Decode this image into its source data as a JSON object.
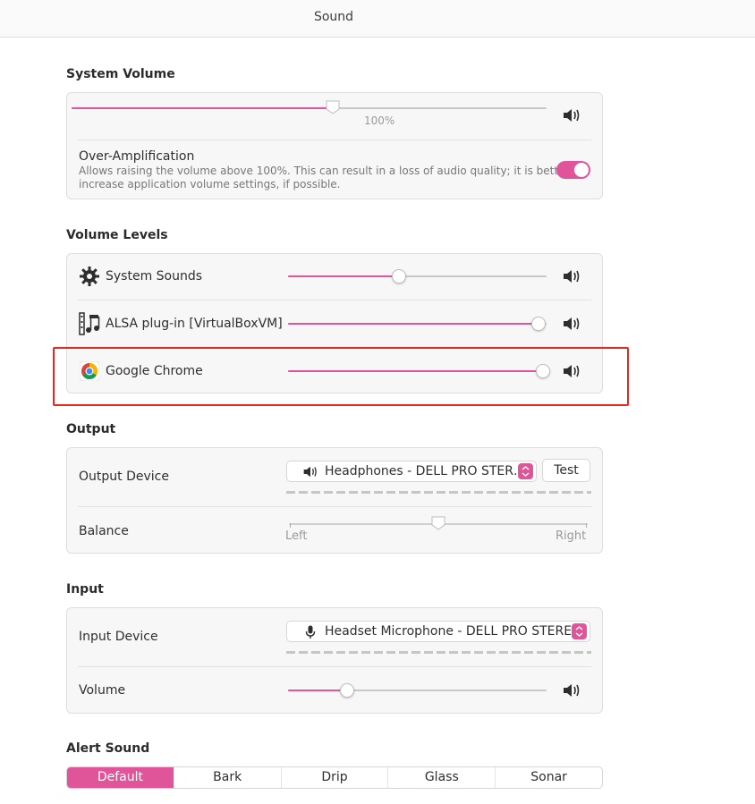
{
  "window": {
    "title": "Sound"
  },
  "system_volume": {
    "section_title": "System Volume",
    "level_percent": 55,
    "value_label": "100%",
    "over_amplification": {
      "label": "Over-Amplification",
      "description_line1": "Allows raising the volume above 100%. This can result in a loss of audio quality; it is better to",
      "description_line2": "increase application volume settings, if possible.",
      "enabled": true
    }
  },
  "volume_levels": {
    "section_title": "Volume Levels",
    "items": [
      {
        "label": "System Sounds",
        "icon": "gear-icon",
        "level_percent": 43
      },
      {
        "label": "ALSA plug-in [VirtualBoxVM]",
        "icon": "film-music-icon",
        "level_percent": 97
      },
      {
        "label": "Google Chrome",
        "icon": "chrome-icon",
        "level_percent": 100
      }
    ]
  },
  "output": {
    "section_title": "Output",
    "device_label": "Output Device",
    "device_value": "Headphones - DELL PRO STER…",
    "test_label": "Test",
    "balance_label": "Balance",
    "balance_left": "Left",
    "balance_right": "Right",
    "balance_position": 0.5
  },
  "input": {
    "section_title": "Input",
    "device_label": "Input Device",
    "device_value": "Headset Microphone - DELL PRO STERE…",
    "volume_label": "Volume",
    "level_percent": 23
  },
  "alert_sound": {
    "section_title": "Alert Sound",
    "options": [
      "Default",
      "Bark",
      "Drip",
      "Glass",
      "Sonar"
    ],
    "selected": "Default"
  },
  "colors": {
    "accent": "#e0559a",
    "highlight": "#e8281e"
  }
}
